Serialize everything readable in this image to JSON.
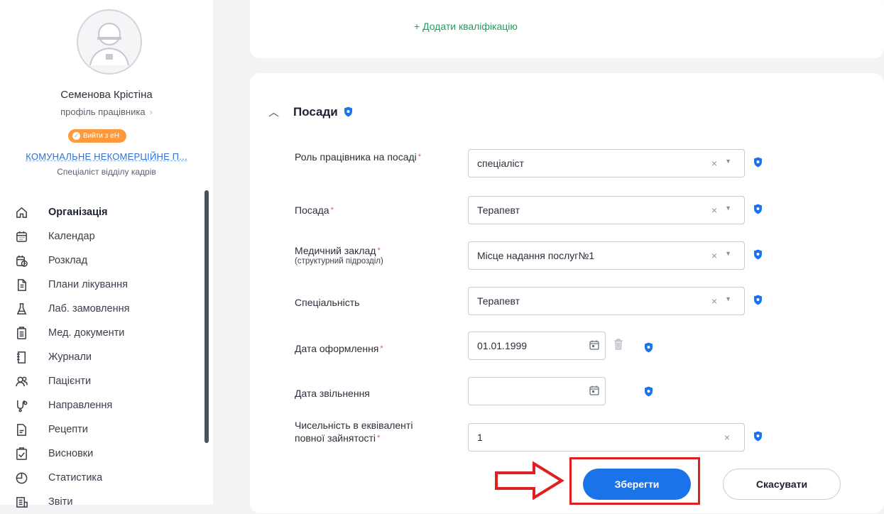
{
  "user": {
    "name": "Семенова Крістіна",
    "profile_link": "профіль працівника",
    "logout_badge": "Вийти з еН",
    "org_name": "КОМУНАЛЬНЕ НЕКОМЕРЦІЙНЕ П...",
    "role": "Спеціаліст відділу кадрів"
  },
  "menu": [
    {
      "label": "Організація",
      "icon": "home-icon",
      "active": true
    },
    {
      "label": "Календар",
      "icon": "calendar-icon"
    },
    {
      "label": "Розклад",
      "icon": "schedule-icon"
    },
    {
      "label": "Плани лікування",
      "icon": "treatment-plan-icon"
    },
    {
      "label": "Лаб. замовлення",
      "icon": "flask-icon"
    },
    {
      "label": "Мед. документи",
      "icon": "medical-document-icon"
    },
    {
      "label": "Журнали",
      "icon": "journal-icon"
    },
    {
      "label": "Пацієнти",
      "icon": "patients-icon"
    },
    {
      "label": "Направлення",
      "icon": "referral-icon"
    },
    {
      "label": "Рецепти",
      "icon": "prescription-icon"
    },
    {
      "label": "Висновки",
      "icon": "conclusion-icon"
    },
    {
      "label": "Статистика",
      "icon": "statistics-icon"
    },
    {
      "label": "Звіти",
      "icon": "reports-icon"
    }
  ],
  "qualification": {
    "add_link": "+ Додати кваліфікацію"
  },
  "section": {
    "title": "Посади"
  },
  "form": {
    "role_label": "Роль працівника на посаді",
    "role_value": "спеціаліст",
    "position_label": "Посада",
    "position_value": "Терапевт",
    "facility_label": "Медичний заклад",
    "facility_sublabel": "(структурний підрозділ)",
    "facility_value": "Місце надання послуг№1",
    "specialty_label": "Спеціальність",
    "specialty_value": "Терапевт",
    "start_date_label": "Дата оформлення",
    "start_date_value": "01.01.1999",
    "end_date_label": "Дата звільнення",
    "end_date_value": "",
    "fte_label": "Чисельність в еквіваленті повної зайнятості",
    "fte_value": "1",
    "clear_symbol": "×",
    "dropdown_symbol": "▼",
    "required_mark": "*"
  },
  "actions": {
    "save": "Зберегти",
    "cancel": "Скасувати"
  },
  "colors": {
    "accent": "#1a73e8",
    "success": "#1e9e5a",
    "warning": "#ff9a3c",
    "highlight": "#e02020"
  }
}
